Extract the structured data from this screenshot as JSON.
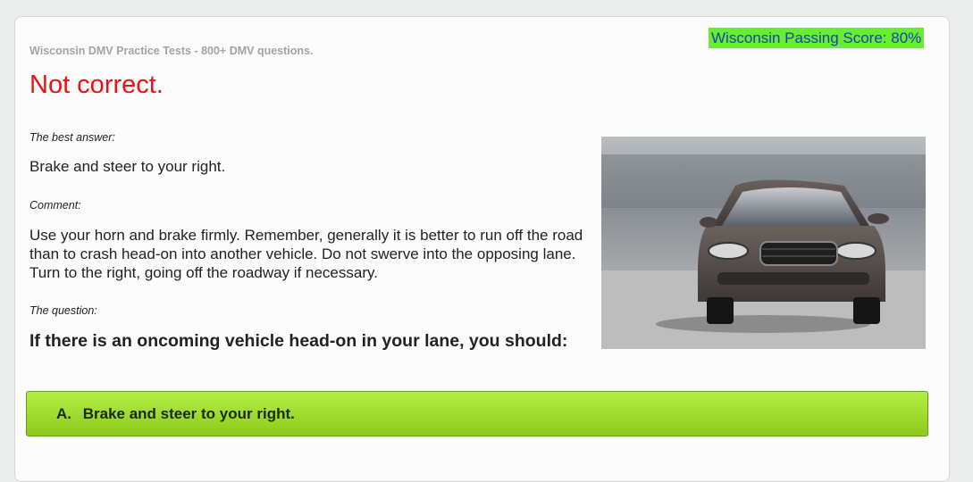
{
  "site": {
    "title": "Wisconsin DMV Practice Tests - 800+ DMV questions."
  },
  "passing_score": {
    "text": "Wisconsin Passing Score: 80%",
    "bg_color": "#66ee33",
    "text_color": "#1f3fb3"
  },
  "result": {
    "text": "Not correct.",
    "color": "#ee1111"
  },
  "best_answer": {
    "label": "The best answer:",
    "text": "Brake and steer to your right."
  },
  "comment": {
    "label": "Comment:",
    "text": "Use your horn and brake firmly. Remember, generally it is better to run off the road than to crash head-on into another vehicle. Do not swerve into the opposing lane. Turn to the right, going off the roadway if necessary."
  },
  "question": {
    "label": "The question:",
    "text": "If there is an oncoming vehicle head-on in your lane, you should:"
  },
  "options": [
    {
      "letter": "A.",
      "text": "Brake and steer to your right.",
      "color": "#9ad82a"
    }
  ]
}
